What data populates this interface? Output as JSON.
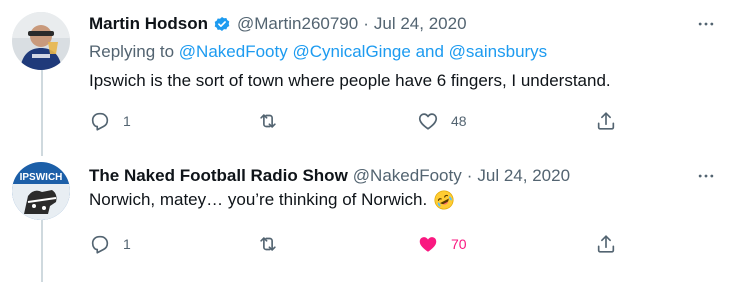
{
  "tweets": [
    {
      "name": "Martin Hodson",
      "verified": true,
      "handle": "@Martin260790",
      "dot": "·",
      "date": "Jul 24, 2020",
      "replying_prefix": "Replying to",
      "replying_mentions": [
        "@NakedFooty",
        "@CynicalGinge"
      ],
      "replying_and": "and",
      "replying_last": "@sainsburys",
      "text": "Ipswich is the sort of town where people have 6 fingers, I understand.",
      "reply_count": "1",
      "retweet_count": "",
      "like_count": "48",
      "liked": false,
      "avatar_icon": "profile-photo"
    },
    {
      "name": "The Naked Football Radio Show",
      "verified": false,
      "handle": "@NakedFooty",
      "dot": "·",
      "date": "Jul 24, 2020",
      "text": "Norwich, matey… you’re thinking of Norwich.",
      "text_emoji": "rolling-on-floor-laughing",
      "avatar_text": "IPSWICH",
      "reply_count": "1",
      "retweet_count": "",
      "like_count": "70",
      "liked": true
    }
  ],
  "colors": {
    "accent": "#1d9bf0",
    "muted": "#536471",
    "like": "#f91880",
    "thread_line": "#cfd9de"
  },
  "icons": [
    "reply-icon",
    "retweet-icon",
    "like-icon",
    "share-icon",
    "more-icon",
    "verified-icon"
  ]
}
